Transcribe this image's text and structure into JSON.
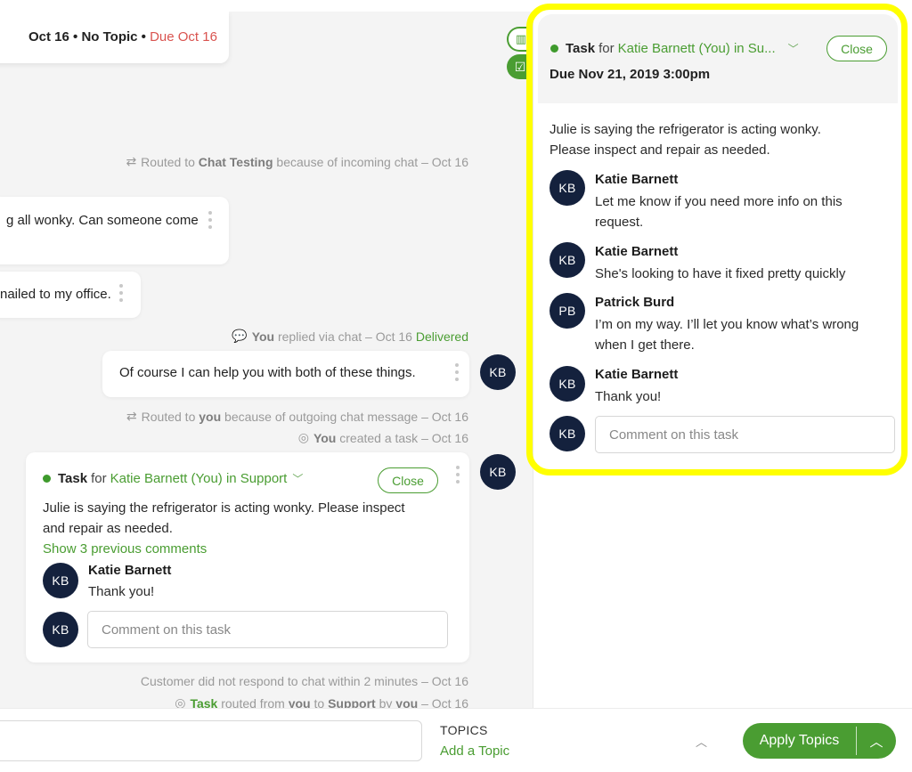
{
  "header": {
    "meta_prefix": "Oct 16 • No Topic • ",
    "due": "Due Oct 16"
  },
  "side_buttons": [
    {
      "icon": "book-icon"
    },
    {
      "icon": "clipboard-check-icon"
    }
  ],
  "events": {
    "routed_chat_testing": {
      "prefix": "Routed to ",
      "bold": "Chat Testing",
      "suffix": " because of incoming chat – Oct 16"
    },
    "replied": {
      "bold": "You",
      "middle": " replied via chat – Oct 16 ",
      "status": "Delivered"
    },
    "routed_you": {
      "prefix": "Routed to ",
      "bold": "you",
      "suffix": " because of outgoing chat message – Oct 16"
    },
    "created_task": {
      "bold": "You",
      "suffix": " created a task – Oct 16"
    },
    "no_response": {
      "text": "Customer did not respond to chat within 2 minutes – Oct 16"
    },
    "task_routed": {
      "green": "Task",
      "p1": " routed from ",
      "b1": "you",
      "p2": " to ",
      "b2": "Support",
      "p3": " by ",
      "b3": "you",
      "p4": " – Oct 16"
    }
  },
  "messages": [
    {
      "text": "g all wonky.  Can someone come"
    },
    {
      "text": "nailed to my office."
    },
    {
      "text": "Of course I can help you with both of these things.",
      "avatar": "KB"
    }
  ],
  "inline_task": {
    "label": "Task",
    "for": "for",
    "assignee": "Katie Barnett (You) in Support",
    "close_label": "Close",
    "description_line1": "Julie is saying the refrigerator is acting wonky. Please inspect",
    "description_line2": "and repair as needed.",
    "show_previous": "Show 3 previous comments",
    "avatar": "KB",
    "comment": {
      "author": "Katie Barnett",
      "text": "Thank you!",
      "avatar": "KB"
    },
    "input_avatar": "KB",
    "comment_placeholder": "Comment on this task"
  },
  "task_panel": {
    "label": "Task",
    "for": "for",
    "assignee": "Katie Barnett (You) in Su...",
    "close_label": "Close",
    "due": "Due Nov 21, 2019 3:00pm",
    "description_line1": "Julie is saying the refrigerator is acting wonky.",
    "description_line2": "Please inspect and repair as needed.",
    "comments": [
      {
        "avatar": "KB",
        "author": "Katie Barnett",
        "line1": "Let me know if you need more info on this",
        "line2": "request."
      },
      {
        "avatar": "KB",
        "author": "Katie Barnett",
        "line1": "She's looking to have it fixed pretty quickly",
        "line2": ""
      },
      {
        "avatar": "PB",
        "author": "Patrick Burd",
        "line1": "I’m on my way. I’ll let you know what’s wrong",
        "line2": "when I get there."
      },
      {
        "avatar": "KB",
        "author": "Katie Barnett",
        "line1": "Thank you!",
        "line2": ""
      }
    ],
    "input_avatar": "KB",
    "comment_placeholder": "Comment on this task"
  },
  "bottom_bar": {
    "topics_label": "TOPICS",
    "add_topic": "Add a Topic",
    "apply_label": "Apply Topics"
  },
  "colors": {
    "accent_green": "#4a9d32",
    "due_red": "#d9534f",
    "avatar_navy": "#14213d",
    "highlight_yellow": "#ffff00"
  }
}
